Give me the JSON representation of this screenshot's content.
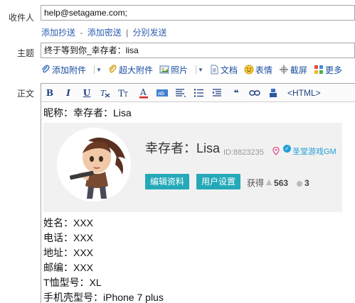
{
  "recipients": {
    "label": "收件人",
    "value": "help@setagame.com;"
  },
  "recipient_links": {
    "add_cc": "添加抄送",
    "sep1": "-",
    "add_bcc": "添加密送",
    "sep2": "|",
    "separate_send": "分别发送"
  },
  "subject": {
    "label": "主题",
    "value": "终于等到你_幸存者：lisa"
  },
  "attach_toolbar": {
    "add_attachment": "添加附件",
    "large_attachment": "超大附件",
    "photo": "照片",
    "document": "文档",
    "emoticon": "表情",
    "screenshot": "截屏",
    "more": "更多"
  },
  "body": {
    "label": "正文",
    "html_button": "<HTML>",
    "format_buttons": {
      "bold": "B",
      "italic": "I",
      "underline": "U"
    },
    "lines": {
      "nickname": "昵称：幸存者：Lisa",
      "name": "姓名：XXX",
      "phone": "电话：XXX",
      "address": "地址：XXX",
      "postcode": "邮编：XXX",
      "tshirt": "T恤型号：XL",
      "phone_case": "手机壳型号：iPhone 7 plus"
    }
  },
  "profile_card": {
    "name": "幸存者：Lisa",
    "id_text": "ID:8823235",
    "verified_label": "圣堂游戏GM",
    "edit_button": "编辑资料",
    "settings_button": "用户设置",
    "gain_label": "获得",
    "points": "563",
    "badges": "3"
  },
  "colors": {
    "link": "#2a5db0",
    "button": "#25a9b8",
    "card_bg": "#f1f1f1",
    "verified": "#1ea0d8"
  }
}
